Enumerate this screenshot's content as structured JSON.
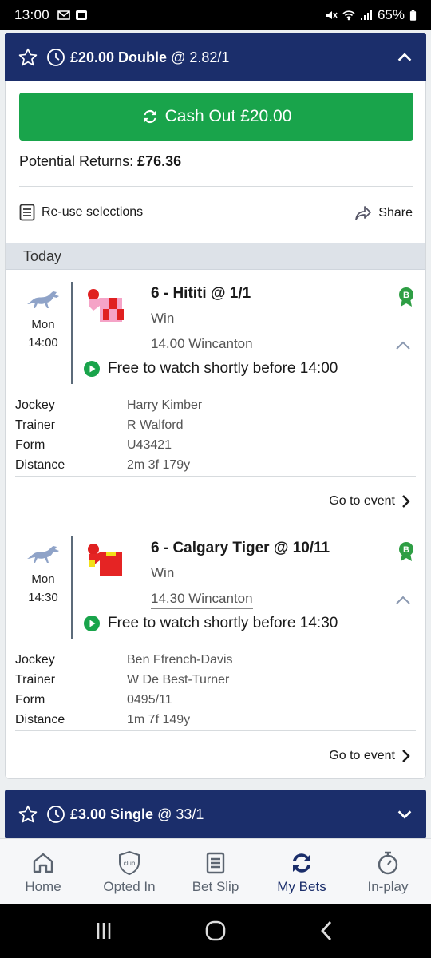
{
  "status_bar": {
    "time": "13:00",
    "battery": "65%"
  },
  "bet1": {
    "stake": "£20.00 Double",
    "odds": "@ 2.82/1",
    "cashout_label": "Cash Out £20.00",
    "potential_label": "Potential Returns:",
    "potential_value": "£76.36",
    "reuse_label": "Re-use selections",
    "share_label": "Share",
    "day_label": "Today",
    "selections": [
      {
        "day": "Mon",
        "time": "14:00",
        "runner": "6 - Hititi @ 1/1",
        "market": "Win",
        "race": "14.00 Wincanton",
        "watch": "Free to watch shortly before 14:00",
        "details": [
          {
            "key": "Jockey",
            "value": "Harry Kimber"
          },
          {
            "key": "Trainer",
            "value": "R Walford"
          },
          {
            "key": "Form",
            "value": "U43421"
          },
          {
            "key": "Distance",
            "value": "2m 3f 179y"
          }
        ],
        "goto_label": "Go to event"
      },
      {
        "day": "Mon",
        "time": "14:30",
        "runner": "6 - Calgary Tiger @ 10/11",
        "market": "Win",
        "race": "14.30 Wincanton",
        "watch": "Free to watch shortly before 14:30",
        "details": [
          {
            "key": "Jockey",
            "value": "Ben Ffrench-Davis"
          },
          {
            "key": "Trainer",
            "value": "W De Best-Turner"
          },
          {
            "key": "Form",
            "value": "0495/11"
          },
          {
            "key": "Distance",
            "value": "1m 7f 149y"
          }
        ],
        "goto_label": "Go to event"
      }
    ]
  },
  "bet2": {
    "stake": "£3.00 Single",
    "odds": "@ 33/1"
  },
  "bottom_nav": [
    {
      "label": "Home",
      "icon": "home-icon"
    },
    {
      "label": "Opted In",
      "icon": "club-shield-icon",
      "icon_text": "club"
    },
    {
      "label": "Bet Slip",
      "icon": "bet-slip-icon"
    },
    {
      "label": "My Bets",
      "icon": "my-bets-icon",
      "active": true
    },
    {
      "label": "In-play",
      "icon": "stopwatch-icon"
    }
  ],
  "colors": {
    "header": "#1b2e6b",
    "cashout": "#19a44b",
    "badge": "#2e9e44"
  }
}
